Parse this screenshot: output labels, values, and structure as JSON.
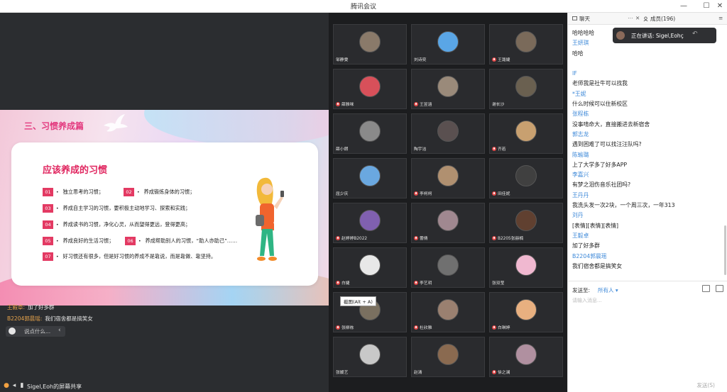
{
  "window": {
    "title": "腾讯会议"
  },
  "slide": {
    "heading": "三、习惯养成篇",
    "card_title": "应该养成的习惯",
    "items": [
      {
        "num": "01",
        "text": "独立思考的习惯；"
      },
      {
        "num": "02",
        "text": "养成锻炼身体的习惯；"
      },
      {
        "num": "03",
        "text": "养成自主学习的习惯，要积极主动地学习、探索和实践；"
      },
      {
        "num": "04",
        "text": "养成读书的习惯，净化心灵，从而望得更远，登得更高；"
      },
      {
        "num": "05",
        "text": "养成良好的生活习惯；"
      },
      {
        "num": "06",
        "text": "养成帮助别人的习惯，“助人亦助己”……"
      },
      {
        "num": "07",
        "text": "好习惯还有很多，但是好习惯的养成不是靠说，而是靠做、靠坚持。"
      }
    ]
  },
  "overlay_chat": [
    {
      "name": "王毅卓:",
      "text": "加了好多群"
    },
    {
      "name": "B2204郭晨瑶:",
      "text": "我们宿舍都是搞笑女"
    }
  ],
  "say_placeholder": "说点什么...",
  "bottom_bar": {
    "sharing_label": "Sigel,Eoh的屏幕共享"
  },
  "participants": [
    {
      "name": "邹静雯",
      "muted": false,
      "color": "#8a7a6a"
    },
    {
      "name": "刘诗奕",
      "muted": false,
      "color": "#5aa6e6"
    },
    {
      "name": "王潞婕",
      "muted": true,
      "color": "#7a6a5a"
    },
    {
      "name": "薛雅咪",
      "muted": true,
      "color": "#d8505a"
    },
    {
      "name": "王昱涵",
      "muted": true,
      "color": "#9a8a7a"
    },
    {
      "name": "谢长沙",
      "muted": false,
      "color": "#6a6050"
    },
    {
      "name": "薛小朗",
      "muted": false,
      "color": "#8a8a8a"
    },
    {
      "name": "陶宇洁",
      "muted": false,
      "color": "#5a5050"
    },
    {
      "name": "齐若",
      "muted": true,
      "color": "#c8a070"
    },
    {
      "name": "屈少庆",
      "muted": false,
      "color": "#6aa8e0"
    },
    {
      "name": "李柯柯",
      "muted": true,
      "color": "#b09070"
    },
    {
      "name": "田佳妮",
      "muted": true,
      "color": "#404040"
    },
    {
      "name": "赵婷婷B2022",
      "muted": true,
      "color": "#8060b0"
    },
    {
      "name": "蕾倩",
      "muted": true,
      "color": "#a08890"
    },
    {
      "name": "B2205张赫楠",
      "muted": true,
      "color": "#604030"
    },
    {
      "name": "白婕",
      "muted": true,
      "color": "#e8e8e8"
    },
    {
      "name": "李艺玥",
      "muted": true,
      "color": "#707070"
    },
    {
      "name": "张双莹",
      "muted": false,
      "color": "#f0b8d0"
    },
    {
      "name": "张柳栋",
      "muted": true,
      "color": "#7a7060"
    },
    {
      "name": "杜欣雅",
      "muted": true,
      "color": "#9a8070"
    },
    {
      "name": "白琳婷",
      "muted": true,
      "color": "#e8b080"
    },
    {
      "name": "张媛艺",
      "muted": false,
      "color": "#c8c8c8"
    },
    {
      "name": "赵清",
      "muted": false,
      "color": "#8a6a50"
    },
    {
      "name": "徐之澜",
      "muted": true,
      "color": "#b090a0"
    }
  ],
  "tooltip": "截图(Alt + A)",
  "panel": {
    "tab_chat": "聊天",
    "tab_members": "成员(196)",
    "speaking": "正在讲话: Sigel,Eohç",
    "messages": [
      {
        "name": "",
        "text": "哈哈哈哈"
      },
      {
        "name": "王妍琪",
        "text": "哈哈"
      },
      {
        "name": "",
        "text": ""
      },
      {
        "name": "IF",
        "text": "老师我是社牛可以找我"
      },
      {
        "name": "*王妮",
        "text": "什么时候可以住新校区"
      },
      {
        "name": "张程栋",
        "text": "没事啃命大，直接搬进去新宿舍"
      },
      {
        "name": "郭志龙",
        "text": "遇到困难了可以找汪汪队吗?"
      },
      {
        "name": "陈瑜璐",
        "text": "上了大学多了好多APP"
      },
      {
        "name": "李嘉兴",
        "text": "有梦之泪伤音乐社团吗?"
      },
      {
        "name": "王丹丹",
        "text": "我洗头发一次2块，一个周三次，一年313"
      },
      {
        "name": "刘丹",
        "text": "[表情][表情][表情]"
      },
      {
        "name": "王毅卓",
        "text": "加了好多群"
      },
      {
        "name": "B2204郭晨瑶",
        "text": "我们宿舍都是搞笑女"
      }
    ],
    "send_to_label": "发送至:",
    "send_to_value": "所有人 ▾",
    "input_placeholder": "请输入消息...",
    "send_button": "发送(S)"
  }
}
